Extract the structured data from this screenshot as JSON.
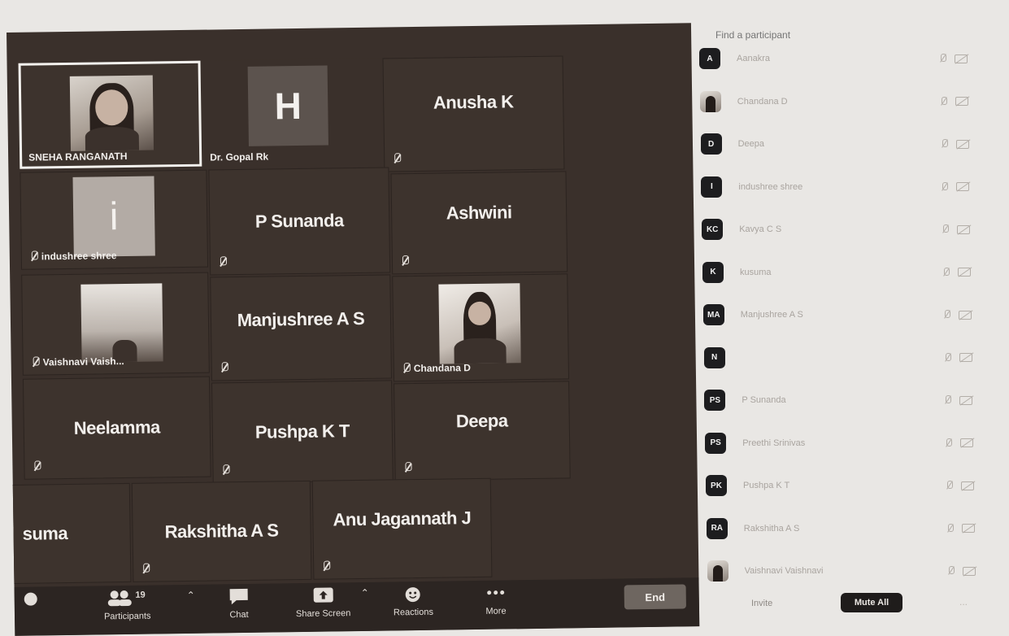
{
  "tiles": {
    "sneha": "SNEHA RANGANATH",
    "gopal": "Dr. Gopal Rk",
    "gopal_initial": "H",
    "anusha": "Anusha K",
    "indushree": "indushree shree",
    "indushree_initial": "i",
    "sunanda": "P Sunanda",
    "ashwini": "Ashwini",
    "vaishnavi": "Vaishnavi Vaish...",
    "manjushree": "Manjushree A S",
    "chandana": "Chandana D",
    "neelamma": "Neelamma",
    "pushpa": "Pushpa K T",
    "deepa": "Deepa",
    "kusuma": "suma",
    "rakshitha": "Rakshitha A S",
    "anu": "Anu Jagannath J"
  },
  "toolbar": {
    "participants_count": "19",
    "participants_label": "Participants",
    "chat_label": "Chat",
    "share_label": "Share Screen",
    "reactions_label": "Reactions",
    "more_label": "More",
    "end_label": "End"
  },
  "panel": {
    "search_placeholder": "Find a participant",
    "participants": [
      {
        "initials": "A",
        "name": "Aanakra"
      },
      {
        "initials": "",
        "name": "Chandana D",
        "photo": true
      },
      {
        "initials": "D",
        "name": "Deepa"
      },
      {
        "initials": "I",
        "name": "indushree shree"
      },
      {
        "initials": "KC",
        "name": "Kavya C S"
      },
      {
        "initials": "K",
        "name": "kusuma"
      },
      {
        "initials": "MA",
        "name": "Manjushree A S"
      },
      {
        "initials": "N",
        "name": ""
      },
      {
        "initials": "PS",
        "name": "P Sunanda"
      },
      {
        "initials": "PS",
        "name": "Preethi Srinivas"
      },
      {
        "initials": "PK",
        "name": "Pushpa K T"
      },
      {
        "initials": "RA",
        "name": "Rakshitha A S"
      },
      {
        "initials": "",
        "name": "Vaishnavi Vaishnavi",
        "photo": true
      }
    ],
    "invite_label": "Invite",
    "mute_all_label": "Mute All",
    "more_label": "..."
  }
}
